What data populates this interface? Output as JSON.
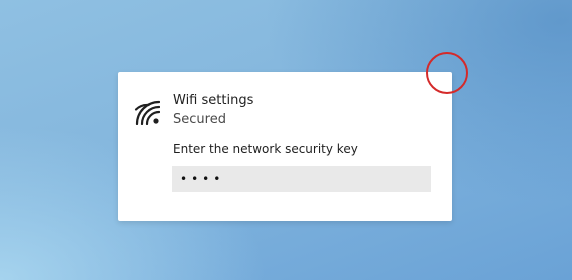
{
  "dialog": {
    "title": "Wifi settings",
    "subtitle": "Secured",
    "prompt": "Enter the network security key",
    "password_value": "••••",
    "icon": "wifi-icon"
  },
  "overlay": {
    "indicator": "click-indicator-circle",
    "color": "#d42a2a"
  }
}
